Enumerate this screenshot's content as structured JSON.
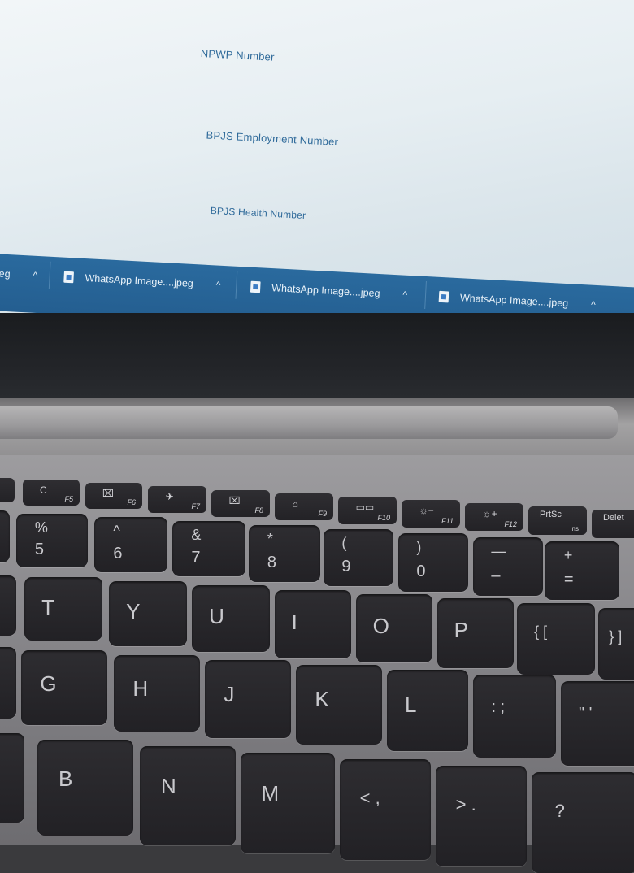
{
  "screen": {
    "form_labels": [
      "NPWP Number",
      "BPJS Employment Number",
      "BPJS Health Number"
    ],
    "downloads_bar": {
      "partial_left": "eg",
      "items": [
        {
          "file": "WhatsApp Image....jpeg"
        },
        {
          "file": "WhatsApp Image....jpeg"
        },
        {
          "file": "WhatsApp Image....jpeg"
        }
      ],
      "caret": "^"
    }
  },
  "keyboard": {
    "function_row": [
      {
        "icon": "C",
        "fn": "F5"
      },
      {
        "icon": "⌧",
        "fn": "F6"
      },
      {
        "icon": "✈",
        "fn": "F7"
      },
      {
        "icon": "⌧",
        "fn": "F8"
      },
      {
        "icon": "⌂",
        "fn": "F9"
      },
      {
        "icon": "▭▭",
        "fn": "F10"
      },
      {
        "icon": "☼−",
        "fn": "F11"
      },
      {
        "icon": "☼+",
        "fn": "F12"
      },
      {
        "line1": "PrtSc",
        "line2": "Ins"
      },
      {
        "line1": "Delet"
      }
    ],
    "number_row": [
      {
        "top": "%",
        "bot": "5"
      },
      {
        "top": "^",
        "bot": "6"
      },
      {
        "top": "&",
        "bot": "7"
      },
      {
        "top": "*",
        "bot": "8"
      },
      {
        "top": "(",
        "bot": "9"
      },
      {
        "top": ")",
        "bot": "0"
      },
      {
        "top": "—",
        "bot": "–"
      },
      {
        "top": "+",
        "bot": "="
      }
    ],
    "top_row": [
      "T",
      "Y",
      "U",
      "I",
      "O",
      "P",
      "{ [",
      "} ]"
    ],
    "home_row": [
      "G",
      "H",
      "J",
      "K",
      "L",
      ": ;",
      "\" '"
    ],
    "bottom_row": [
      "B",
      "N",
      "M",
      "< ,",
      "> .",
      "?"
    ]
  }
}
